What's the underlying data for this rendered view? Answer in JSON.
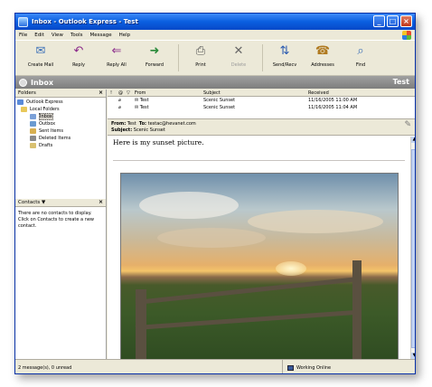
{
  "window": {
    "title": "Inbox - Outlook Express - Test"
  },
  "menu": [
    "File",
    "Edit",
    "View",
    "Tools",
    "Message",
    "Help"
  ],
  "toolbar": {
    "items": [
      {
        "label": "Create Mail",
        "icon": "create-mail-icon",
        "glyph": "✉"
      },
      {
        "label": "Reply",
        "icon": "reply-icon",
        "glyph": "↶"
      },
      {
        "label": "Reply All",
        "icon": "reply-all-icon",
        "glyph": "⇐"
      },
      {
        "label": "Forward",
        "icon": "forward-icon",
        "glyph": "➜"
      },
      {
        "label": "Print",
        "icon": "print-icon",
        "glyph": "⎙"
      },
      {
        "label": "Delete",
        "icon": "delete-icon",
        "glyph": "✕"
      },
      {
        "label": "Send/Recv",
        "icon": "send-receive-icon",
        "glyph": "⇅"
      },
      {
        "label": "Addresses",
        "icon": "addresses-icon",
        "glyph": "☎"
      },
      {
        "label": "Find",
        "icon": "find-icon",
        "glyph": "⌕"
      }
    ]
  },
  "folderbar": {
    "title": "Inbox",
    "identity": "Test"
  },
  "folders": {
    "header": "Folders",
    "items": [
      {
        "label": "Outlook Express",
        "level": 0
      },
      {
        "label": "Local Folders",
        "level": 1
      },
      {
        "label": "Inbox",
        "level": 2
      },
      {
        "label": "Outbox",
        "level": 2
      },
      {
        "label": "Sent Items",
        "level": 2
      },
      {
        "label": "Deleted Items",
        "level": 2
      },
      {
        "label": "Drafts",
        "level": 2
      }
    ]
  },
  "contacts": {
    "header": "Contacts ▼",
    "message": "There are no contacts to display. Click on Contacts to create a new contact."
  },
  "messagelist": {
    "columns": [
      "!",
      "@",
      "▽",
      "From",
      "Subject",
      "Received"
    ],
    "rows": [
      {
        "from": "Test",
        "subject": "Scenic Sunset",
        "received": "11/16/2005 11:00 AM"
      },
      {
        "from": "Test",
        "subject": "Scenic Sunset",
        "received": "11/16/2005 11:04 AM"
      }
    ]
  },
  "preview": {
    "from_label": "From:",
    "from": "Test",
    "to_label": "To:",
    "to": "testac@hevanet.com",
    "subject_label": "Subject:",
    "subject": "Scenic Sunset",
    "body": "Here is my sunset picture."
  },
  "status": {
    "count": "2 message(s), 0 unread",
    "connection": "Working Online"
  }
}
